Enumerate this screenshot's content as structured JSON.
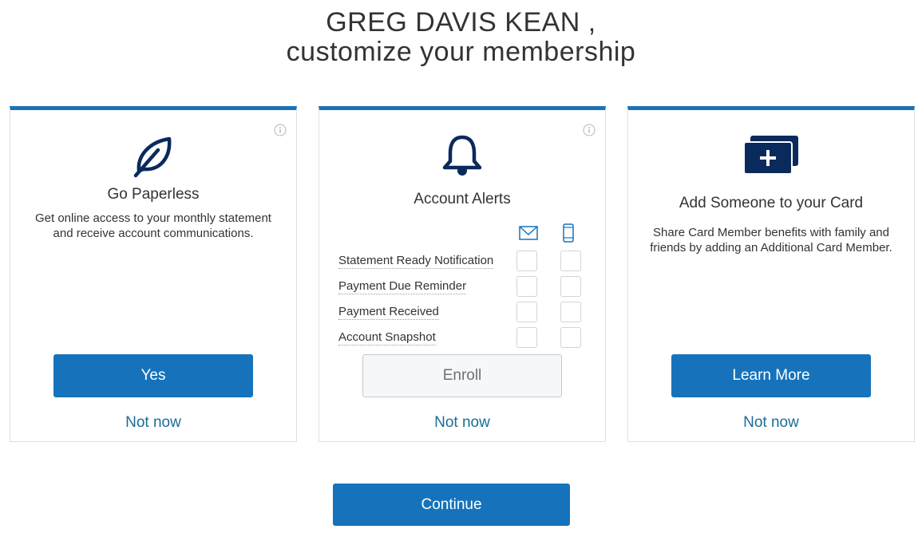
{
  "heading": {
    "name_line": "GREG DAVIS KEAN ,",
    "subtitle": "customize your membership"
  },
  "cards": {
    "paperless": {
      "icon": "leaf-icon",
      "title": "Go Paperless",
      "description": "Get online access to your monthly statement and receive account communications.",
      "primary_label": "Yes",
      "secondary_label": "Not now"
    },
    "alerts": {
      "icon": "bell-icon",
      "title": "Account Alerts",
      "channels": [
        "email-icon",
        "mobile-phone-icon"
      ],
      "rows": [
        {
          "label": "Statement Ready Notification"
        },
        {
          "label": "Payment Due Reminder"
        },
        {
          "label": "Payment Received"
        },
        {
          "label": "Account Snapshot"
        }
      ],
      "primary_label": "Enroll",
      "secondary_label": "Not now"
    },
    "add_member": {
      "icon": "add-card-icon",
      "title": "Add Someone to your Card",
      "description": "Share Card Member benefits with family and friends by adding an Additional Card Member.",
      "primary_label": "Learn More",
      "secondary_label": "Not now"
    }
  },
  "continue_label": "Continue",
  "colors": {
    "accent": "#1673bb",
    "navy_icon": "#0b2a5c",
    "link": "#1a6e96"
  }
}
